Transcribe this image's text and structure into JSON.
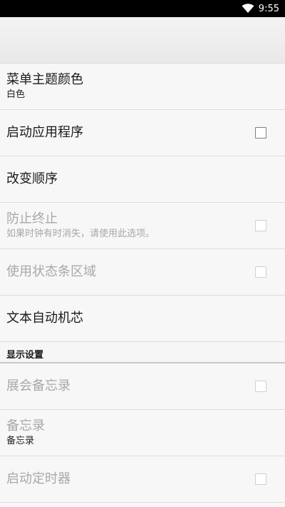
{
  "status_bar": {
    "time": "9:55"
  },
  "toolbar": {
    "title": ""
  },
  "settings": [
    {
      "title": "菜单主题颜色",
      "summary": "白色",
      "has_checkbox": false,
      "enabled": true
    },
    {
      "title": "启动应用程序",
      "summary": "",
      "has_checkbox": true,
      "checked": false,
      "enabled": true
    },
    {
      "title": "改变顺序",
      "summary": "",
      "has_checkbox": false,
      "enabled": true
    },
    {
      "title": "防止终止",
      "summary": "如果时钟有时消失，请使用此选项。",
      "has_checkbox": true,
      "checked": false,
      "enabled": false
    },
    {
      "title": "使用状态条区域",
      "summary": "",
      "has_checkbox": true,
      "checked": false,
      "enabled": false
    },
    {
      "title": "文本自动机芯",
      "summary": "",
      "has_checkbox": false,
      "enabled": true
    }
  ],
  "display_section": {
    "header": "显示设置",
    "items": [
      {
        "title": "展会备忘录",
        "summary": "",
        "has_checkbox": true,
        "checked": false,
        "enabled": false
      },
      {
        "title": "备忘录",
        "summary": "备忘录",
        "has_checkbox": false,
        "enabled": true
      },
      {
        "title": "启动定时器",
        "summary": "",
        "has_checkbox": true,
        "checked": false,
        "enabled": false
      }
    ]
  },
  "colors": {
    "status_bar_bg": "#000000",
    "background": "#f7f7f7",
    "divider": "#dcdcdc",
    "disabled_text": "#a8a8a8",
    "primary_text": "#1a1a1a"
  }
}
